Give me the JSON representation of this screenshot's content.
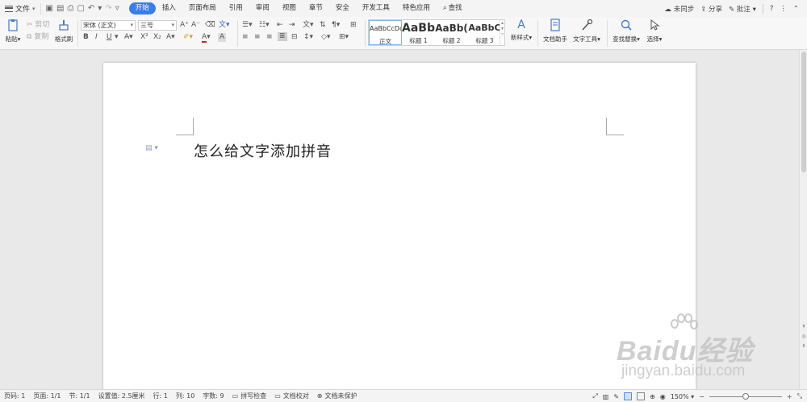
{
  "menubar": {
    "file_label": "文件",
    "tabs": [
      {
        "label": "开始",
        "active": true
      },
      {
        "label": "插入"
      },
      {
        "label": "页面布局"
      },
      {
        "label": "引用"
      },
      {
        "label": "审阅"
      },
      {
        "label": "视图"
      },
      {
        "label": "章节"
      },
      {
        "label": "安全"
      },
      {
        "label": "开发工具"
      },
      {
        "label": "特色应用"
      }
    ],
    "search_label": "查找",
    "sync_label": "未同步",
    "share_label": "分享",
    "comment_label": "批注",
    "help_label": "?",
    "accent_color": "#3b7de8"
  },
  "ribbon": {
    "paste_label": "粘贴",
    "cut_label": "剪切",
    "copy_label": "复制",
    "format_painter_label": "格式刷",
    "font_name": "宋体 (正文)",
    "font_size": "三号",
    "bold": "B",
    "italic": "I",
    "underline": "U",
    "font_color_letter": "A",
    "styles": [
      {
        "preview": "AaBbCcDd",
        "name": "正文",
        "selected": true
      },
      {
        "preview": "AaBb",
        "name": "标题 1"
      },
      {
        "preview": "AaBb(",
        "name": "标题 2"
      },
      {
        "preview": "AaBbC",
        "name": "标题 3"
      }
    ],
    "new_style_label": "新样式",
    "doc_assistant_label": "文档助手",
    "text_tools_label": "文字工具",
    "find_replace_label": "查找替换",
    "select_label": "选择"
  },
  "document": {
    "title_text": "怎么给文字添加拼音"
  },
  "statusbar": {
    "page_num": "页码: 1",
    "pages": "页面: 1/1",
    "section": "节: 1/1",
    "setting": "设置值: 2.5厘米",
    "row": "行: 1",
    "col": "列: 10",
    "word_count": "字数: 9",
    "spell_check": "拼写检查",
    "doc_proof": "文档校对",
    "doc_protect": "文档未保护",
    "zoom": "150%",
    "zoom_minus": "−",
    "zoom_plus": "+",
    "zoom_level": 0.5
  },
  "watermark": {
    "brand": "Baidu经验",
    "url": "jingyan.baidu.com"
  }
}
